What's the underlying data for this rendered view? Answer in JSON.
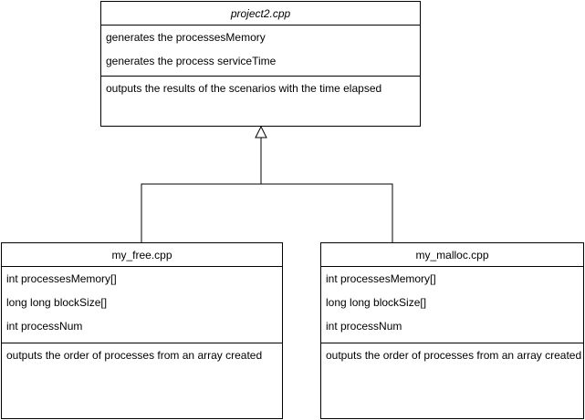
{
  "parent_class": {
    "name": "project2.cpp",
    "attributes": [
      "generates the processesMemory",
      "generates the process serviceTime"
    ],
    "methods": [
      "outputs the results of the scenarios with the time elapsed"
    ]
  },
  "child_classes": [
    {
      "name": "my_free.cpp",
      "attributes": [
        "int processesMemory[]",
        "long long blockSize[]",
        "int processNum"
      ],
      "methods": [
        "outputs the order of processes from an array created"
      ]
    },
    {
      "name": "my_malloc.cpp",
      "attributes": [
        "int processesMemory[]",
        "long long blockSize[]",
        "int processNum"
      ],
      "methods": [
        "outputs the order of processes from an array created"
      ]
    }
  ],
  "relationship": "inheritance"
}
